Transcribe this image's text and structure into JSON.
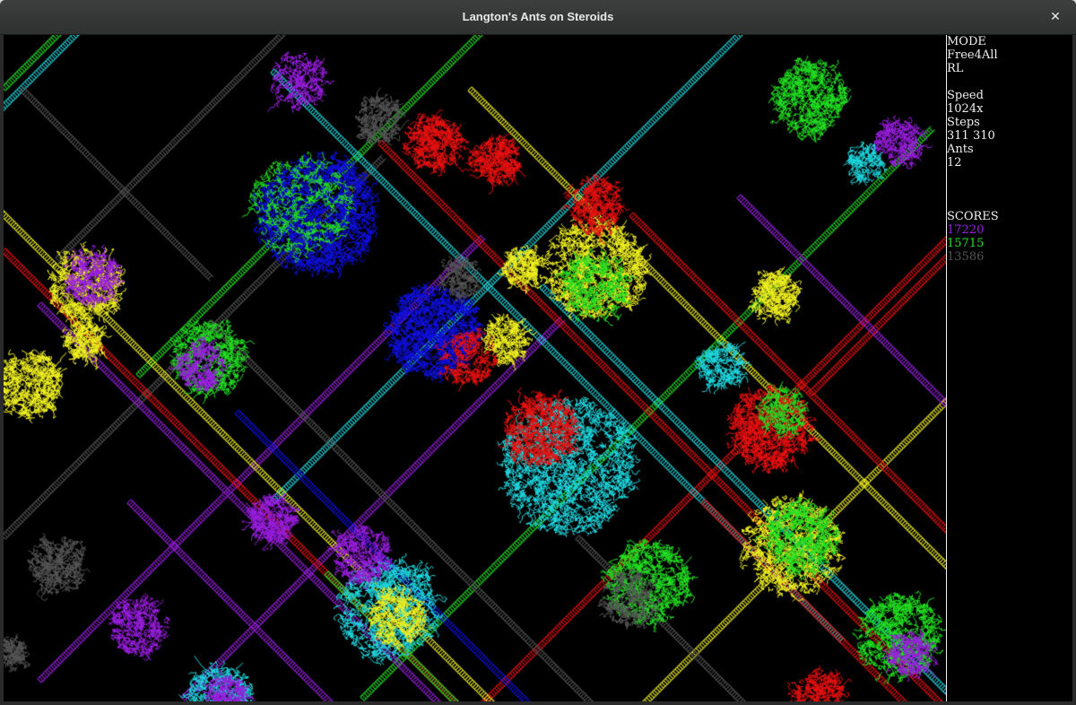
{
  "window": {
    "title": "Langton's Ants on Steroids",
    "close_glyph": "✕"
  },
  "sidebar": {
    "mode_label": "MODE",
    "mode_value": "Free4All",
    "rule": "RL",
    "speed_label": "Speed",
    "speed_value": "1024x",
    "steps_label": "Steps",
    "steps_value": "311 310",
    "ants_label": "Ants",
    "ants_value": "12",
    "scores_label": "SCORES",
    "scores": [
      {
        "value": "17220",
        "color": "#9a1ee0"
      },
      {
        "value": "15715",
        "color": "#22e022"
      },
      {
        "value": "13586",
        "color": "#555555"
      }
    ]
  },
  "simulation": {
    "ant_colors": [
      "#9a1ee0",
      "#22e022",
      "#555555",
      "#e81010",
      "#1010e0",
      "#1ed8e0",
      "#f0f020"
    ]
  }
}
